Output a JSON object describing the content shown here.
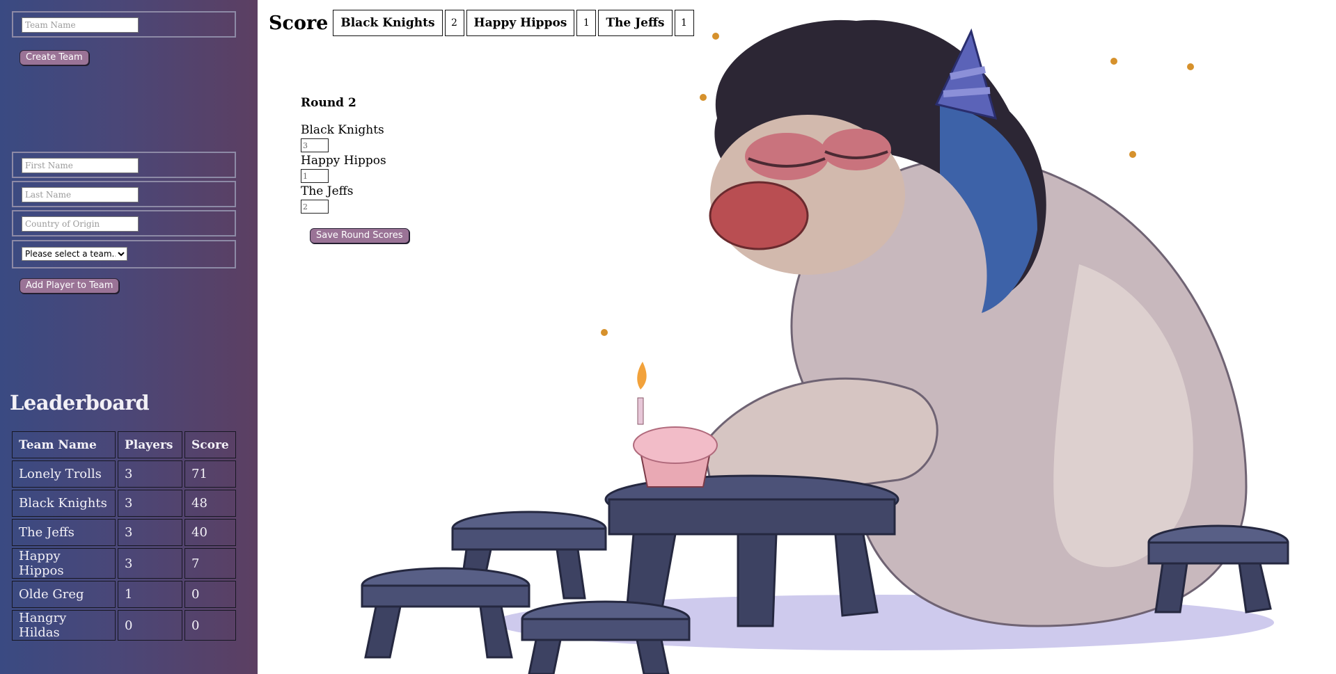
{
  "team_form": {
    "team_name_placeholder": "Team Name",
    "create_label": "Create Team"
  },
  "player_form": {
    "first_name_placeholder": "First Name",
    "last_name_placeholder": "Last Name",
    "country_placeholder": "Country of Origin",
    "team_select_value": "Please select a team...",
    "add_label": "Add Player to Team"
  },
  "leaderboard": {
    "title": "Leaderboard",
    "headers": [
      "Team Name",
      "Players",
      "Score"
    ],
    "rows": [
      [
        "Lonely Trolls",
        "3",
        "71"
      ],
      [
        "Black Knights",
        "3",
        "48"
      ],
      [
        "The Jeffs",
        "3",
        "40"
      ],
      [
        "Happy Hippos",
        "3",
        "7"
      ],
      [
        "Olde Greg",
        "1",
        "0"
      ],
      [
        "Hangry Hildas",
        "0",
        "0"
      ]
    ]
  },
  "scorebar": {
    "label": "Score",
    "teams": [
      {
        "name": "Black Knights",
        "score": "2"
      },
      {
        "name": "Happy Hippos",
        "score": "1"
      },
      {
        "name": "The Jeffs",
        "score": "1"
      }
    ]
  },
  "round": {
    "title": "Round 2",
    "teams": [
      {
        "name": "Black Knights",
        "value": "3"
      },
      {
        "name": "Happy Hippos",
        "value": "1"
      },
      {
        "name": "The Jeffs",
        "value": "2"
      }
    ],
    "save_label": "Save Round Scores"
  },
  "colors": {
    "sidebar_left": "#3a4a82",
    "sidebar_right": "#5c3f62",
    "button_bg": "#9a7396"
  },
  "illustration": {
    "subject": "troll-with-birthday-cupcake-icon"
  }
}
